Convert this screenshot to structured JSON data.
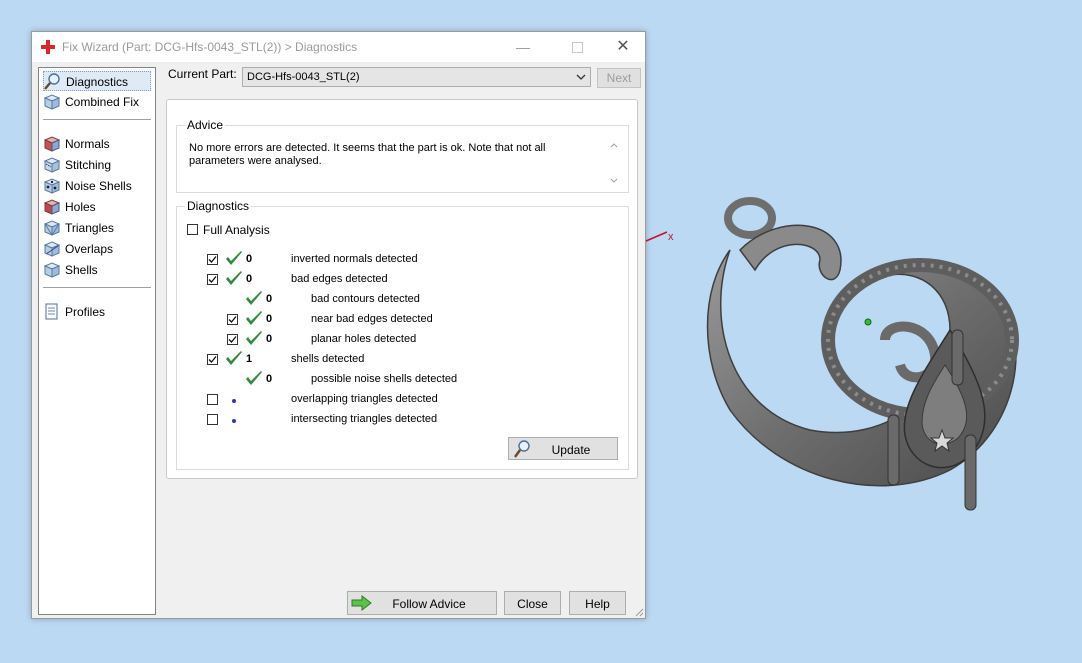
{
  "window": {
    "title": "Fix Wizard (Part: DCG-Hfs-0043_STL(2)) > Diagnostics",
    "minimize_glyph": "—",
    "close_glyph": "✕",
    "title_icon": "red-cross-icon"
  },
  "nav": {
    "items": [
      {
        "label": "Diagnostics",
        "icon": "magnifier-icon"
      },
      {
        "label": "Combined Fix",
        "icon": "cube-icon"
      },
      {
        "label": "Normals",
        "icon": "normals-cube-icon"
      },
      {
        "label": "Stitching",
        "icon": "stitching-icon"
      },
      {
        "label": "Noise Shells",
        "icon": "noise-shells-icon"
      },
      {
        "label": "Holes",
        "icon": "holes-cube-icon"
      },
      {
        "label": "Triangles",
        "icon": "triangles-icon"
      },
      {
        "label": "Overlaps",
        "icon": "overlaps-icon"
      },
      {
        "label": "Shells",
        "icon": "shells-icon"
      },
      {
        "label": "Profiles",
        "icon": "document-icon"
      }
    ],
    "selected": "Diagnostics"
  },
  "header": {
    "current_part_label": "Current Part:",
    "current_part_value": "DCG-Hfs-0043_STL(2)",
    "next_label": "Next"
  },
  "advice": {
    "title": "Advice",
    "text": "No more errors are detected. It seems that the part is ok. Note that not all parameters were analysed."
  },
  "diagnostics": {
    "title": "Diagnostics",
    "full_analysis_label": "Full Analysis",
    "rows": [
      {
        "checkbox": true,
        "checked": true,
        "status": "ok",
        "count": "0",
        "label": "inverted normals detected",
        "indent": 0
      },
      {
        "checkbox": true,
        "checked": true,
        "status": "ok",
        "count": "0",
        "label": "bad edges detected",
        "indent": 0
      },
      {
        "checkbox": false,
        "checked": false,
        "status": "ok",
        "count": "0",
        "label": "bad contours detected",
        "indent": 1
      },
      {
        "checkbox": true,
        "checked": true,
        "status": "ok",
        "count": "0",
        "label": "near bad edges detected",
        "indent": 1
      },
      {
        "checkbox": true,
        "checked": true,
        "status": "ok",
        "count": "0",
        "label": "planar holes detected",
        "indent": 1
      },
      {
        "checkbox": true,
        "checked": true,
        "status": "ok",
        "count": "1",
        "label": "shells detected",
        "indent": 0
      },
      {
        "checkbox": false,
        "checked": false,
        "status": "ok",
        "count": "0",
        "label": "possible noise shells detected",
        "indent": 1
      },
      {
        "checkbox": true,
        "checked": false,
        "status": "pending",
        "count": "",
        "label": "overlapping triangles detected",
        "indent": 0
      },
      {
        "checkbox": true,
        "checked": false,
        "status": "pending",
        "count": "",
        "label": "intersecting triangles detected",
        "indent": 0
      }
    ],
    "update_label": "Update"
  },
  "footer": {
    "follow_advice_label": "Follow Advice",
    "close_label": "Close",
    "help_label": "Help"
  },
  "viewport": {
    "axis_label": "x",
    "background": "#bcd9f4",
    "model_color": "#7a7a7a"
  },
  "colors": {
    "check_green": "#2e8b3a",
    "pending_dot": "#2a3aa8",
    "axis_red": "#c8102e",
    "title_cross": "#d9262a"
  }
}
